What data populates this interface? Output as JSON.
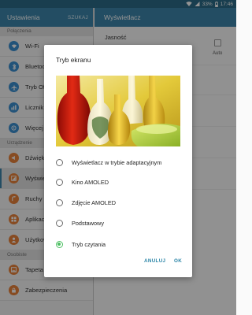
{
  "status_bar": {
    "battery": "33%",
    "time": "17:46"
  },
  "left_pane": {
    "title": "Ustawienia",
    "search_label": "SZUKAJ",
    "sections": [
      {
        "label": "Połączenia"
      },
      {
        "label": "Urządzenie"
      },
      {
        "label": "Osobiste"
      }
    ],
    "items": [
      {
        "label": "Wi-Fi",
        "icon": "wifi-icon",
        "color": "#3c8fd0"
      },
      {
        "label": "Bluetooth",
        "icon": "bluetooth-icon",
        "color": "#3c8fd0"
      },
      {
        "label": "Tryb Offline",
        "icon": "airplane-icon",
        "color": "#3c8fd0"
      },
      {
        "label": "Licznik danych",
        "icon": "data-usage-icon",
        "color": "#3c8fd0"
      },
      {
        "label": "Więcej sieci",
        "icon": "more-networks-icon",
        "color": "#3c8fd0"
      },
      {
        "label": "Dźwięki i powiadomienia",
        "icon": "sound-icon",
        "color": "#e8823a"
      },
      {
        "label": "Wyświetlacz",
        "icon": "display-icon",
        "color": "#e8823a"
      },
      {
        "label": "Ruchy i gesty",
        "icon": "motion-icon",
        "color": "#e8823a"
      },
      {
        "label": "Aplikacje",
        "icon": "apps-icon",
        "color": "#e8823a"
      },
      {
        "label": "Użytkownicy",
        "icon": "users-icon",
        "color": "#e8823a"
      },
      {
        "label": "Tapeta",
        "icon": "wallpaper-icon",
        "color": "#e8823a"
      },
      {
        "label": "Zabezpieczenia",
        "icon": "lock-icon",
        "color": "#e8823a"
      }
    ]
  },
  "right_pane": {
    "title": "Wyświetlacz",
    "brightness_label": "Jasność",
    "auto_label": "Auto"
  },
  "dialog": {
    "title": "Tryb ekranu",
    "options": [
      {
        "label": "Wyświetlacz w trybie adaptacyjnym",
        "selected": false
      },
      {
        "label": "Kino AMOLED",
        "selected": false
      },
      {
        "label": "Zdjęcie AMOLED",
        "selected": false
      },
      {
        "label": "Podstawowy",
        "selected": false
      },
      {
        "label": "Tryb czytania",
        "selected": true
      }
    ],
    "cancel_label": "ANULUJ",
    "ok_label": "OK"
  },
  "colors": {
    "header": "#3d86ab",
    "statusbar": "#2b6c88",
    "accent_green": "#4cbf62",
    "button_blue": "#2d86a8"
  }
}
